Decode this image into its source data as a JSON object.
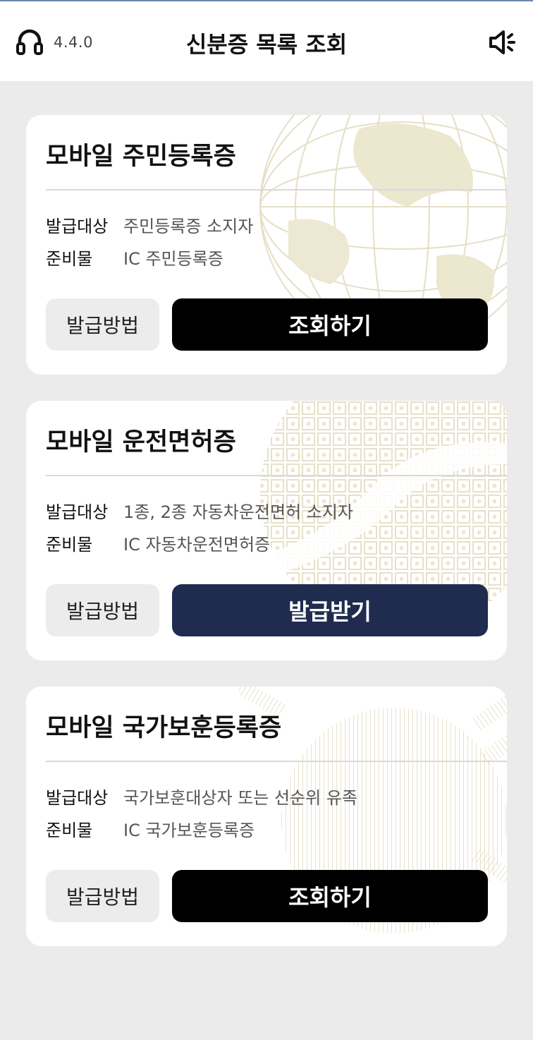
{
  "header": {
    "version": "4.4.0",
    "title": "신분증 목록 조회",
    "headset_icon": "headset-icon",
    "speaker_icon": "speaker-icon"
  },
  "labels": {
    "target": "발급대상",
    "materials": "준비물",
    "method_button": "발급방법"
  },
  "cards": [
    {
      "title": "모바일 주민등록증",
      "target": "주민등록증 소지자",
      "materials": "IC 주민등록증",
      "action": "조회하기",
      "action_color": "#000000"
    },
    {
      "title": "모바일 운전면허증",
      "target": "1종, 2종 자동차운전면허 소지자",
      "materials": "IC 자동차운전면허증",
      "action": "발급받기",
      "action_color": "#1f2c4f"
    },
    {
      "title": "모바일 국가보훈등록증",
      "target": "국가보훈대상자 또는 선순위 유족",
      "materials": "IC 국가보훈등록증",
      "action": "조회하기",
      "action_color": "#000000"
    }
  ]
}
